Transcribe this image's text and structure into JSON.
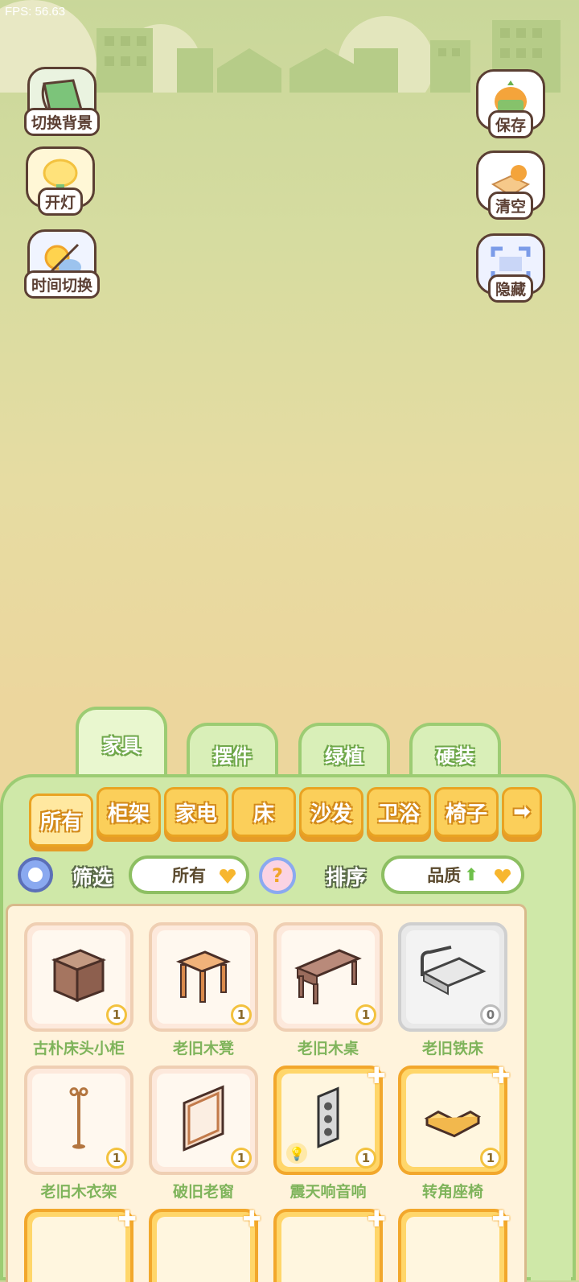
{
  "fps": "FPS: 56.63",
  "left_buttons": [
    {
      "label": "切换背景",
      "icon": "green-scroll-icon"
    },
    {
      "label": "开灯",
      "icon": "lamp-icon"
    },
    {
      "label": "时间切换",
      "icon": "sun-moon-icon"
    }
  ],
  "right_buttons": [
    {
      "label": "保存",
      "icon": "carrot-mascot-icon"
    },
    {
      "label": "清空",
      "icon": "box-mascot-icon"
    },
    {
      "label": "隐藏",
      "icon": "frame-icon"
    }
  ],
  "category_tabs": [
    "家具",
    "摆件",
    "绿植",
    "硬装"
  ],
  "sub_tabs": [
    "所有",
    "柜架",
    "家电",
    "床",
    "沙发",
    "卫浴",
    "椅子"
  ],
  "filter": {
    "label": "筛选",
    "value": "所有"
  },
  "help": "?",
  "sort": {
    "label": "排序",
    "value": "品质"
  },
  "items": [
    {
      "name": "古朴床头小柜",
      "count": "1",
      "rarity": "normal",
      "icon": "nightstand-icon"
    },
    {
      "name": "老旧木凳",
      "count": "1",
      "rarity": "normal",
      "icon": "wooden-stool-icon"
    },
    {
      "name": "老旧木桌",
      "count": "1",
      "rarity": "normal",
      "icon": "wooden-desk-icon"
    },
    {
      "name": "老旧铁床",
      "count": "0",
      "rarity": "gray",
      "icon": "iron-bed-icon"
    },
    {
      "name": "老旧木衣架",
      "count": "1",
      "rarity": "normal",
      "icon": "coat-rack-icon"
    },
    {
      "name": "破旧老窗",
      "count": "1",
      "rarity": "normal",
      "icon": "window-icon"
    },
    {
      "name": "震天响音响",
      "count": "1",
      "rarity": "gold",
      "icon": "speaker-icon"
    },
    {
      "name": "转角座椅",
      "count": "1",
      "rarity": "gold",
      "icon": "corner-sofa-icon"
    }
  ],
  "colors": {
    "panel_green": "#cfe8a8",
    "tab_orange": "#fbcf5a",
    "name_green": "#7fb45b"
  }
}
